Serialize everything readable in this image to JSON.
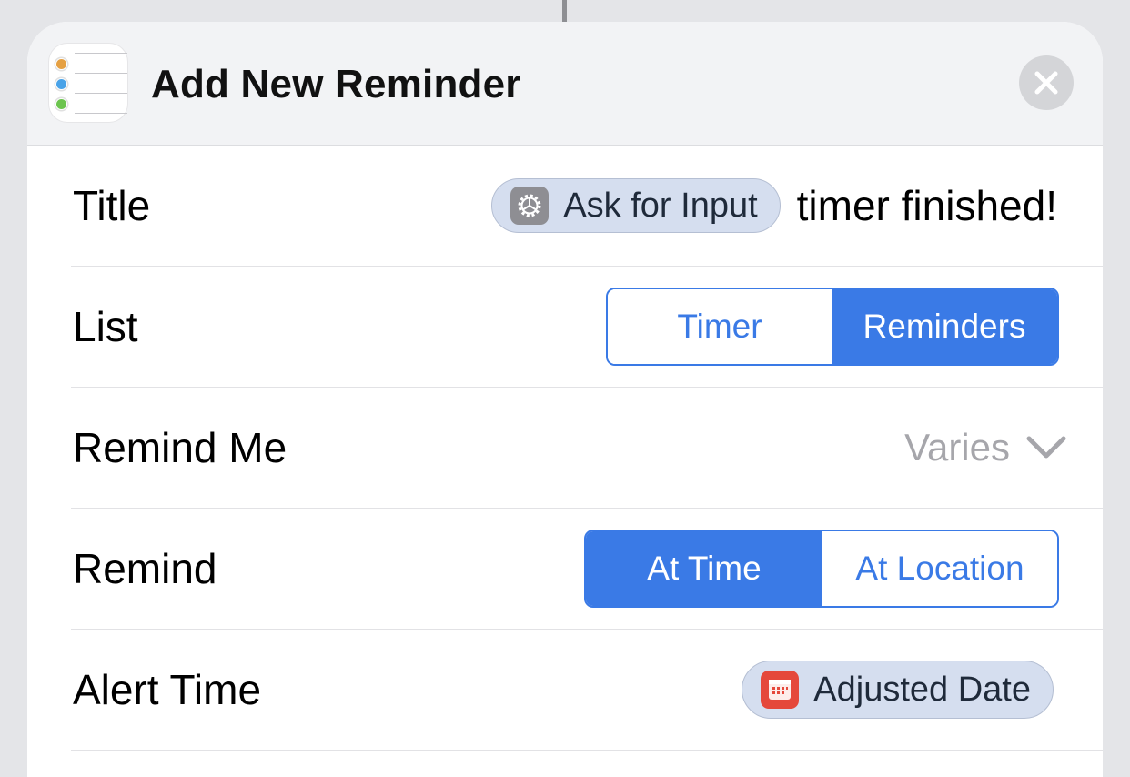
{
  "header": {
    "title": "Add New Reminder",
    "app_icon": "reminders-app-icon",
    "close_icon": "close-icon"
  },
  "rows": {
    "title": {
      "label": "Title",
      "variable_label": "Ask for Input",
      "variable_icon": "gear-icon",
      "text_value": "timer finished!"
    },
    "list": {
      "label": "List",
      "options": [
        "Timer",
        "Reminders"
      ],
      "selected": "Reminders"
    },
    "remind_me": {
      "label": "Remind Me",
      "value": "Varies",
      "icon": "chevron-down-icon"
    },
    "remind": {
      "label": "Remind",
      "options": [
        "At Time",
        "At Location"
      ],
      "selected": "At Time"
    },
    "alert_time": {
      "label": "Alert Time",
      "variable_label": "Adjusted Date",
      "variable_icon": "calendar-icon"
    }
  },
  "colors": {
    "accent": "#3a7ae6",
    "variable_pill": "#d5deef",
    "calendar_icon": "#e5483b",
    "gear_icon": "#8e8e93"
  }
}
